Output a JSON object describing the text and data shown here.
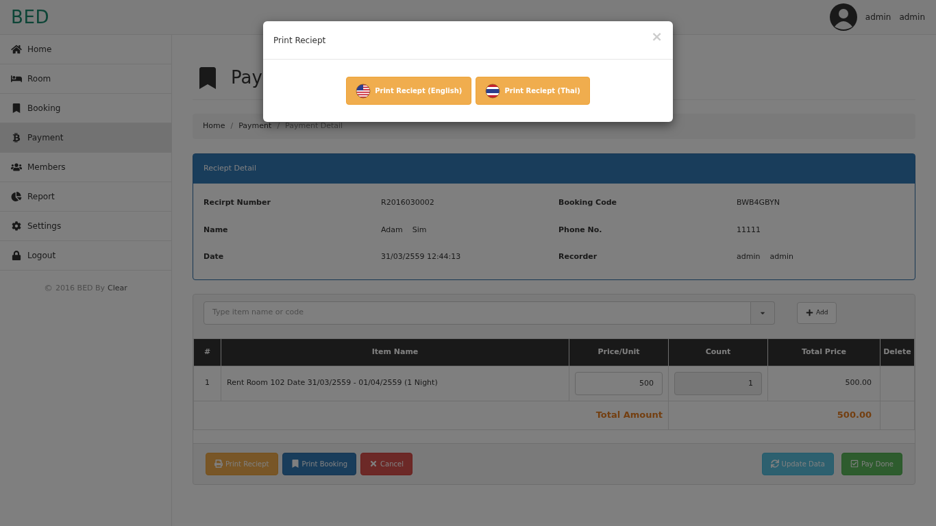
{
  "header": {
    "logo": "BED",
    "user_first": "admin",
    "user_last": "admin"
  },
  "sidebar": {
    "items": [
      {
        "label": "Home",
        "selected": false
      },
      {
        "label": "Room",
        "selected": false
      },
      {
        "label": "Booking",
        "selected": false
      },
      {
        "label": "Payment",
        "selected": true
      },
      {
        "label": "Members",
        "selected": false
      },
      {
        "label": "Report",
        "selected": false
      },
      {
        "label": "Settings",
        "selected": false
      },
      {
        "label": "Logout",
        "selected": false
      }
    ],
    "footer": {
      "copyright": "©",
      "text": "2016 BED By",
      "link": "Clear"
    }
  },
  "page": {
    "title": "Pay",
    "breadcrumb": [
      {
        "label": "Home",
        "active": false
      },
      {
        "separator": "/",
        "label": "Payment",
        "active": false
      },
      {
        "separator": "/",
        "label": "Payment Detail",
        "active": true
      }
    ]
  },
  "receipt": {
    "title": "Reciept Detail",
    "fields": [
      {
        "label": "Recirpt Number",
        "value": "R2016030002"
      },
      {
        "label": "Booking Code",
        "value": "BWB4GBYN"
      },
      {
        "label": "Name",
        "value": "Adam    Sim"
      },
      {
        "label": "Phone No.",
        "value": "11111"
      },
      {
        "label": "Date",
        "value": "31/03/2559 12:44:13"
      },
      {
        "label": "Recorder",
        "value": "admin    admin"
      }
    ]
  },
  "items": {
    "search": {
      "placeholder": "Type item name or code"
    },
    "add_button": "Add",
    "table": {
      "columns": [
        "#",
        "Item Name",
        "Price/Unit",
        "Count",
        "Total Price",
        "Delete"
      ],
      "rows": [
        {
          "no": "1",
          "name": "Rent Room 102 Date 31/03/2559 - 01/04/2559 (1 Night)",
          "price": "500",
          "count": "1",
          "total": "500.00"
        }
      ],
      "total_label": "Total Amount",
      "total_value": "500.00"
    }
  },
  "actions": [
    {
      "label": "Print Reciept",
      "kind": "warning"
    },
    {
      "label": "Print Booking",
      "kind": "primary"
    },
    {
      "label": "Cancel",
      "kind": "danger"
    },
    {
      "label": "Update Data",
      "kind": "info"
    },
    {
      "label": "Pay Done",
      "kind": "success"
    }
  ],
  "modal": {
    "title": "Print Reciept",
    "close": "×",
    "buttons": [
      {
        "label": "Print Reciept (English)",
        "kind": "us"
      },
      {
        "label": "Print Reciept (Thai)",
        "kind": "th"
      }
    ]
  }
}
